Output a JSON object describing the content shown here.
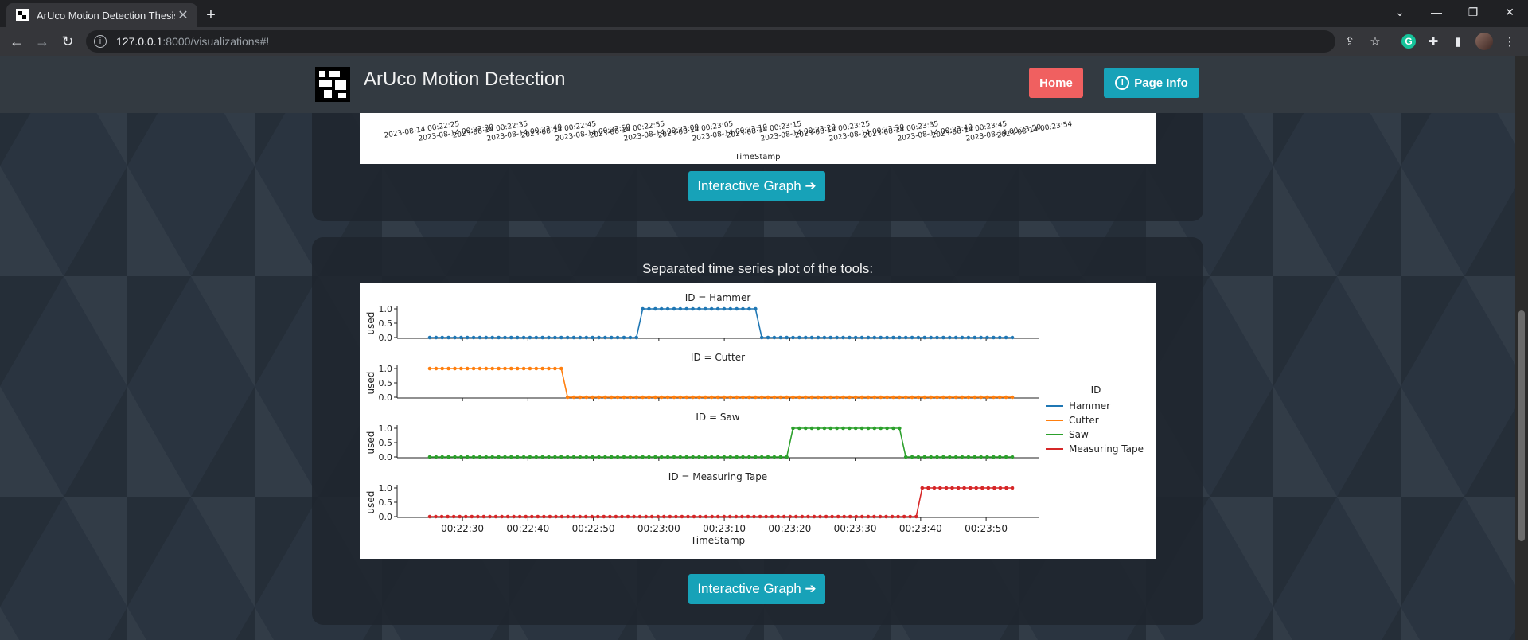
{
  "browser": {
    "tab_title": "ArUco Motion Detection Thesis",
    "url_host": "127.0.0.1",
    "url_path": ":8000/visualizations#!"
  },
  "navbar": {
    "brand": "ArUco Motion Detection",
    "home_label": "Home",
    "page_info_label": "Page Info"
  },
  "top_plot": {
    "x_label": "TimeStamp",
    "tick_labels": [
      "2023-08-14 00:22:25",
      "2023-08-14 00:22:30",
      "2023-08-14 00:22:35",
      "2023-08-14 00:22:40",
      "2023-08-14 00:22:45",
      "2023-08-14 00:22:50",
      "2023-08-14 00:22:55",
      "2023-08-14 00:23:00",
      "2023-08-14 00:23:05",
      "2023-08-14 00:23:10",
      "2023-08-14 00:23:15",
      "2023-08-14 00:23:20",
      "2023-08-14 00:23:25",
      "2023-08-14 00:23:30",
      "2023-08-14 00:23:35",
      "2023-08-14 00:23:40",
      "2023-08-14 00:23:45",
      "2023-08-14 00:23:50",
      "2023-08-14 00:23:54"
    ]
  },
  "section2": {
    "caption": "Separated time series plot of the tools:"
  },
  "buttons": {
    "interactive_graph": "Interactive Graph ➔"
  },
  "chart_data": {
    "type": "line",
    "xlabel": "TimeStamp",
    "ylabel": "used",
    "x_start": "00:22:25",
    "x_end": "00:23:54",
    "x_ticks": [
      "00:22:30",
      "00:22:40",
      "00:22:50",
      "00:23:00",
      "00:23:10",
      "00:23:20",
      "00:23:30",
      "00:23:40",
      "00:23:50"
    ],
    "y_ticks": [
      "0.0",
      "0.5",
      "1.0"
    ],
    "ylim": [
      0,
      1
    ],
    "legend_title": "ID",
    "legend_position": "right",
    "series": [
      {
        "name": "Hammer",
        "panel_title": "ID = Hammer",
        "color": "#1f77b4",
        "values": [
          0,
          0,
          0,
          0,
          0,
          0,
          0,
          0,
          0,
          0,
          0,
          0,
          0,
          0,
          0,
          0,
          0,
          0,
          0,
          0,
          0,
          0,
          0,
          0,
          0,
          0,
          0,
          0,
          0,
          0,
          0,
          0,
          0,
          0,
          1,
          1,
          1,
          1,
          1,
          1,
          1,
          1,
          1,
          1,
          1,
          1,
          1,
          1,
          1,
          1,
          1,
          1,
          1,
          0,
          0,
          0,
          0,
          0,
          0,
          0,
          0,
          0,
          0,
          0,
          0,
          0,
          0,
          0,
          0,
          0,
          0,
          0,
          0,
          0,
          0,
          0,
          0,
          0,
          0,
          0,
          0,
          0,
          0,
          0,
          0,
          0,
          0,
          0,
          0,
          0,
          0,
          0,
          0,
          0
        ]
      },
      {
        "name": "Cutter",
        "panel_title": "ID = Cutter",
        "color": "#ff7f0e",
        "values": [
          1,
          1,
          1,
          1,
          1,
          1,
          1,
          1,
          1,
          1,
          1,
          1,
          1,
          1,
          1,
          1,
          1,
          1,
          1,
          1,
          1,
          1,
          0,
          0,
          0,
          0,
          0,
          0,
          0,
          0,
          0,
          0,
          0,
          0,
          0,
          0,
          0,
          0,
          0,
          0,
          0,
          0,
          0,
          0,
          0,
          0,
          0,
          0,
          0,
          0,
          0,
          0,
          0,
          0,
          0,
          0,
          0,
          0,
          0,
          0,
          0,
          0,
          0,
          0,
          0,
          0,
          0,
          0,
          0,
          0,
          0,
          0,
          0,
          0,
          0,
          0,
          0,
          0,
          0,
          0,
          0,
          0,
          0,
          0,
          0,
          0,
          0,
          0,
          0,
          0,
          0,
          0,
          0,
          0
        ]
      },
      {
        "name": "Saw",
        "panel_title": "ID = Saw",
        "color": "#2ca02c",
        "values": [
          0,
          0,
          0,
          0,
          0,
          0,
          0,
          0,
          0,
          0,
          0,
          0,
          0,
          0,
          0,
          0,
          0,
          0,
          0,
          0,
          0,
          0,
          0,
          0,
          0,
          0,
          0,
          0,
          0,
          0,
          0,
          0,
          0,
          0,
          0,
          0,
          0,
          0,
          0,
          0,
          0,
          0,
          0,
          0,
          0,
          0,
          0,
          0,
          0,
          0,
          0,
          0,
          0,
          0,
          0,
          0,
          0,
          0,
          1,
          1,
          1,
          1,
          1,
          1,
          1,
          1,
          1,
          1,
          1,
          1,
          1,
          1,
          1,
          1,
          1,
          1,
          0,
          0,
          0,
          0,
          0,
          0,
          0,
          0,
          0,
          0,
          0,
          0,
          0,
          0,
          0,
          0,
          0,
          0
        ]
      },
      {
        "name": "Measuring Tape",
        "panel_title": "ID = Measuring Tape",
        "color": "#d62728",
        "values": [
          0,
          0,
          0,
          0,
          0,
          0,
          0,
          0,
          0,
          0,
          0,
          0,
          0,
          0,
          0,
          0,
          0,
          0,
          0,
          0,
          0,
          0,
          0,
          0,
          0,
          0,
          0,
          0,
          0,
          0,
          0,
          0,
          0,
          0,
          0,
          0,
          0,
          0,
          0,
          0,
          0,
          0,
          0,
          0,
          0,
          0,
          0,
          0,
          0,
          0,
          0,
          0,
          0,
          0,
          0,
          0,
          0,
          0,
          0,
          0,
          0,
          0,
          0,
          0,
          0,
          0,
          0,
          0,
          0,
          0,
          0,
          0,
          0,
          0,
          0,
          0,
          0,
          0,
          0,
          0,
          0,
          0,
          1,
          1,
          1,
          1,
          1,
          1,
          1,
          1,
          1,
          1,
          1,
          1,
          1,
          1,
          1,
          1
        ]
      }
    ]
  }
}
